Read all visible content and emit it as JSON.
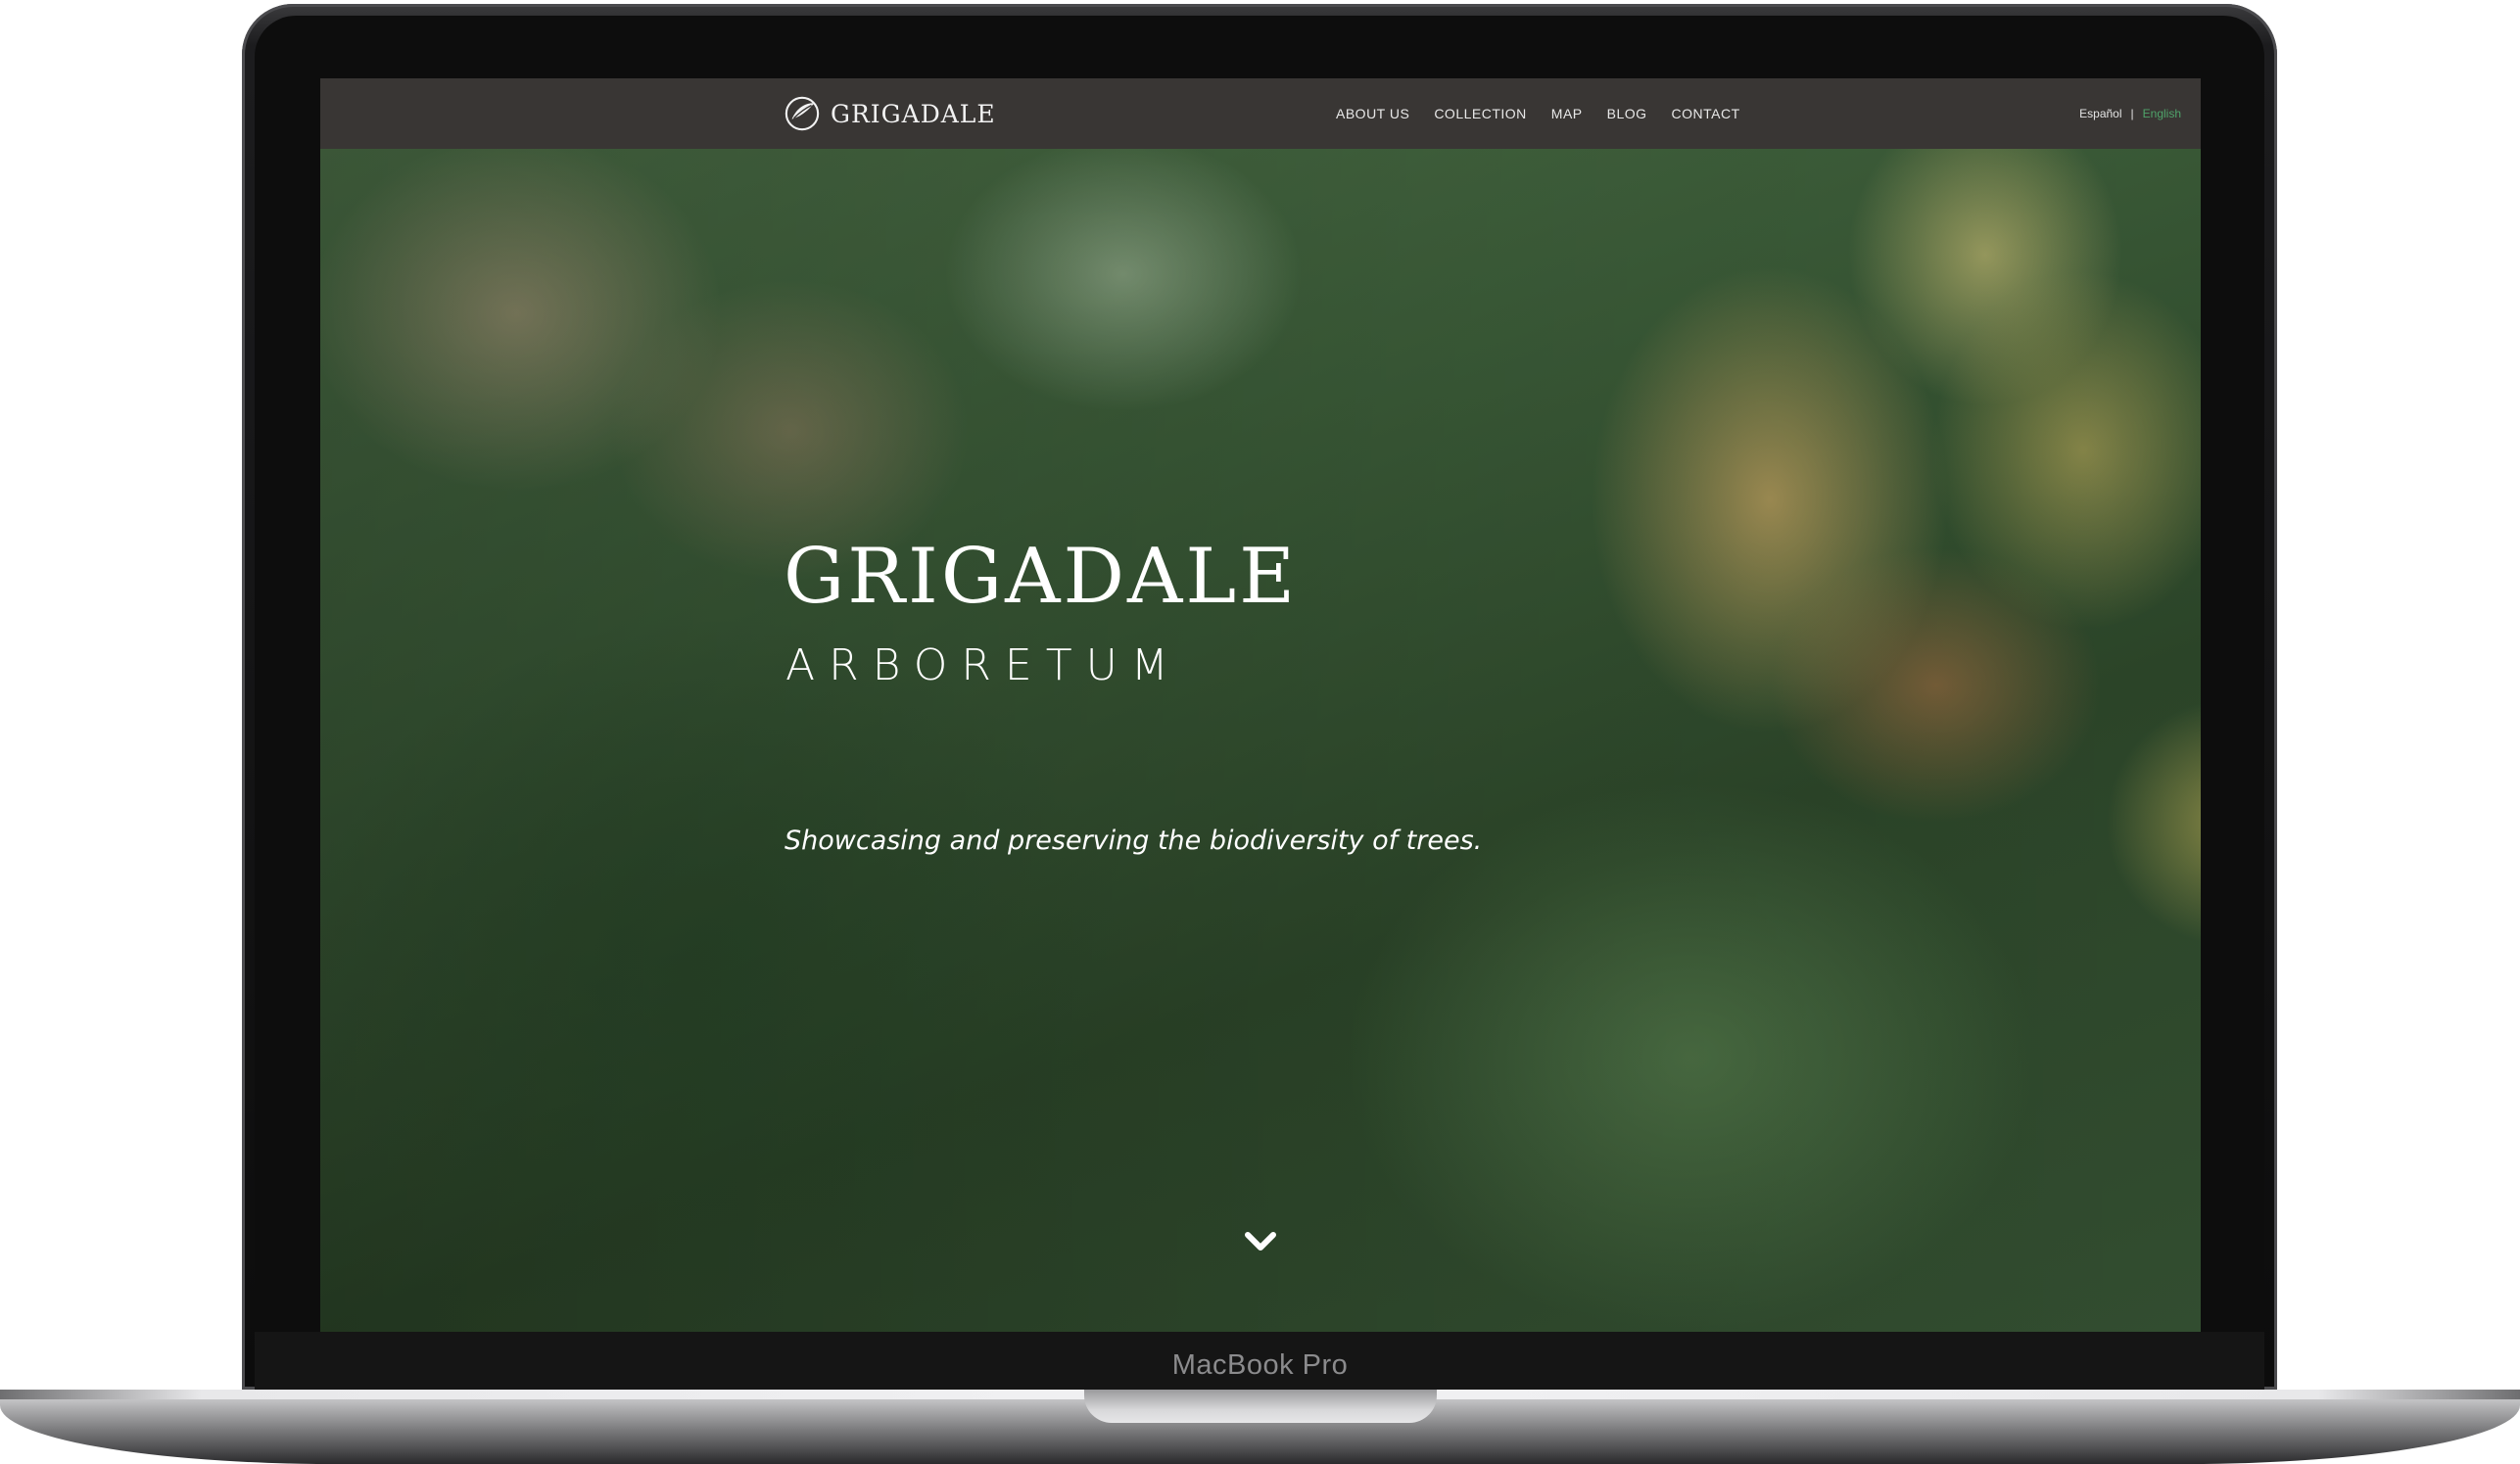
{
  "device": {
    "label": "MacBook Pro"
  },
  "site": {
    "logo_text": "GRIGADALE",
    "nav": [
      {
        "label": "ABOUT US"
      },
      {
        "label": "COLLECTION"
      },
      {
        "label": "MAP"
      },
      {
        "label": "BLOG"
      },
      {
        "label": "CONTACT"
      }
    ],
    "languages": {
      "spanish": "Español",
      "separator": "|",
      "english": "English",
      "active_color": "#4fa36a"
    },
    "nav_bg_color": "#393634"
  },
  "hero": {
    "title": "GRIGADALE",
    "subtitle": "ARBORETUM",
    "tagline": "Showcasing and preserving the biodiversity of trees.",
    "scroll_icon": "chevron-down-icon"
  }
}
